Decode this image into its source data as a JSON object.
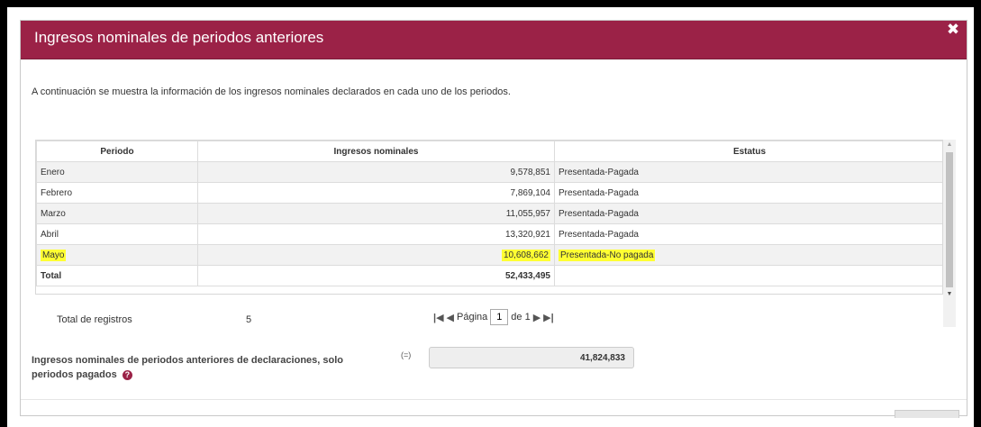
{
  "modal": {
    "title": "Ingresos nominales de periodos anteriores",
    "close_glyph": "✖",
    "intro": "A continuación se muestra la información de los ingresos nominales declarados en cada uno de los periodos."
  },
  "table": {
    "headers": [
      "Periodo",
      "Ingresos nominales",
      "Estatus"
    ],
    "rows": [
      {
        "periodo": "Enero",
        "ingresos": "9,578,851",
        "estatus": "Presentada-Pagada"
      },
      {
        "periodo": "Febrero",
        "ingresos": "7,869,104",
        "estatus": "Presentada-Pagada"
      },
      {
        "periodo": "Marzo",
        "ingresos": "11,055,957",
        "estatus": "Presentada-Pagada"
      },
      {
        "periodo": "Abril",
        "ingresos": "13,320,921",
        "estatus": "Presentada-Pagada"
      },
      {
        "periodo": "Mayo",
        "ingresos": "10,608,662",
        "estatus": "Presentada-No pagada"
      }
    ],
    "total": {
      "label": "Total",
      "ingresos": "52,433,495",
      "estatus": ""
    }
  },
  "records": {
    "label": "Total de registros",
    "count": "5"
  },
  "pager": {
    "first_glyph": "|◀",
    "prev_glyph": "◀",
    "page_label": "Página",
    "page_value": "1",
    "of_label": "de 1",
    "next_glyph": "▶",
    "last_glyph": "▶|"
  },
  "summary": {
    "label": "Ingresos nominales de periodos anteriores de declaraciones, solo periodos pagados",
    "equals": "(=)",
    "value": "41,824,833"
  },
  "colors": {
    "header": "#9b2247",
    "highlight": "#ffff33"
  },
  "icons": {
    "help": "help-icon",
    "close": "close-icon"
  }
}
